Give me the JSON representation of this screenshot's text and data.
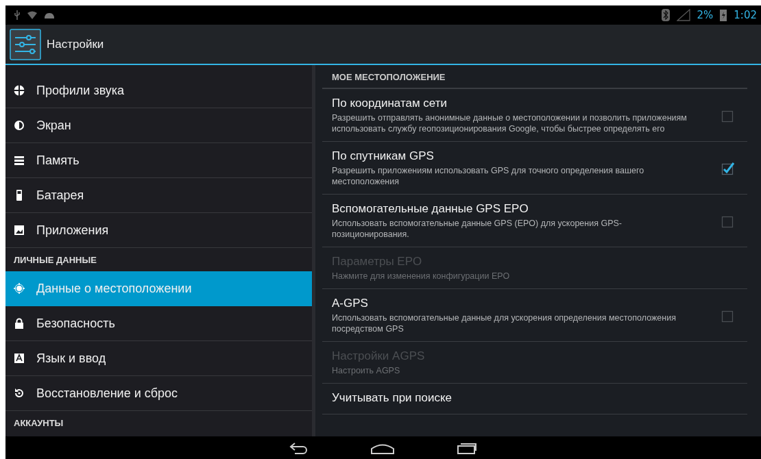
{
  "status_bar": {
    "battery": "2%",
    "time": "1:02"
  },
  "action_bar": {
    "title": "Настройки"
  },
  "sidebar": {
    "items": [
      {
        "kind": "item",
        "label": "Профили звука",
        "selected": false
      },
      {
        "kind": "item",
        "label": "Экран",
        "selected": false
      },
      {
        "kind": "item",
        "label": "Память",
        "selected": false
      },
      {
        "kind": "item",
        "label": "Батарея",
        "selected": false
      },
      {
        "kind": "item",
        "label": "Приложения",
        "selected": false
      },
      {
        "kind": "header",
        "label": "ЛИЧНЫЕ ДАННЫЕ"
      },
      {
        "kind": "item",
        "label": "Данные о местоположении",
        "selected": true
      },
      {
        "kind": "item",
        "label": "Безопасность",
        "selected": false
      },
      {
        "kind": "item",
        "label": "Язык и ввод",
        "selected": false
      },
      {
        "kind": "item",
        "label": "Восстановление и сброс",
        "selected": false
      },
      {
        "kind": "header",
        "label": "АККАУНТЫ"
      }
    ]
  },
  "content": {
    "section_header": "МОЕ МЕСТОПОЛОЖЕНИЕ",
    "rows": [
      {
        "kind": "checkbox",
        "title": "По координатам сети",
        "summary": "Разрешить отправлять анонимные данные о местоположении и позволить приложениям использовать службу геопозиционирования Google, чтобы быстрее определять его",
        "disabled": false,
        "checked": false
      },
      {
        "kind": "checkbox",
        "title": "По спутникам GPS",
        "summary": "Разрешить приложениям использовать GPS для точного определения вашего местоположения",
        "disabled": false,
        "checked": true
      },
      {
        "kind": "checkbox",
        "title": "Вспомогательные данные GPS EPO",
        "summary": "Использовать вспомогательные данные GPS (EPO) для ускорения GPS-позиционирования.",
        "disabled": false,
        "checked": false
      },
      {
        "kind": "plain",
        "title": "Параметры EPO",
        "summary": "Нажмите для изменения конфигурации EPO",
        "disabled": true
      },
      {
        "kind": "checkbox",
        "title": "A-GPS",
        "summary": "Использовать вспомогательные данные для ускорения определения местоположения посредством GPS",
        "disabled": false,
        "checked": false
      },
      {
        "kind": "plain",
        "title": "Настройки AGPS",
        "summary": "Настроить AGPS",
        "disabled": true
      },
      {
        "kind": "plain",
        "title": "Учитывать при поиске",
        "disabled": false
      }
    ]
  }
}
